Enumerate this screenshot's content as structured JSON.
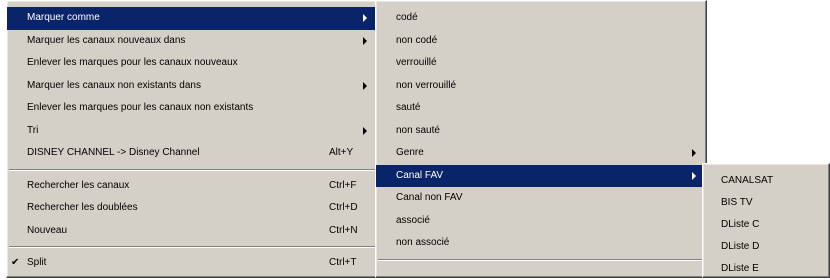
{
  "menu1": {
    "items": [
      {
        "label": "Marquer comme"
      },
      {
        "label": "Marquer les canaux nouveaux dans"
      },
      {
        "label": "Enlever les marques pour les canaux nouveaux"
      },
      {
        "label": "Marquer les canaux non existants dans"
      },
      {
        "label": "Enlever les marques pour les canaux non existants"
      },
      {
        "label": "Tri"
      },
      {
        "label": "DISNEY CHANNEL -> Disney Channel",
        "shortcut": "Alt+Y"
      },
      {
        "label": "Rechercher les canaux",
        "shortcut": "Ctrl+F"
      },
      {
        "label": "Rechercher les doublées",
        "shortcut": "Ctrl+D"
      },
      {
        "label": "Nouveau",
        "shortcut": "Ctrl+N"
      },
      {
        "label": "Split",
        "shortcut": "Ctrl+T",
        "check": "✔"
      }
    ]
  },
  "menu2": {
    "items": [
      {
        "label": "codé"
      },
      {
        "label": "non codé"
      },
      {
        "label": "verrouillé"
      },
      {
        "label": "non verrouillé"
      },
      {
        "label": "sauté"
      },
      {
        "label": "non sauté"
      },
      {
        "label": "Genre"
      },
      {
        "label": "Canal FAV"
      },
      {
        "label": "Canal non FAV"
      },
      {
        "label": "associé"
      },
      {
        "label": "non associé"
      }
    ]
  },
  "menu3": {
    "items": [
      {
        "label": "CANALSAT"
      },
      {
        "label": "BIS TV"
      },
      {
        "label": "DListe  C"
      },
      {
        "label": "DListe  D"
      },
      {
        "label": "DListe  E"
      }
    ]
  }
}
